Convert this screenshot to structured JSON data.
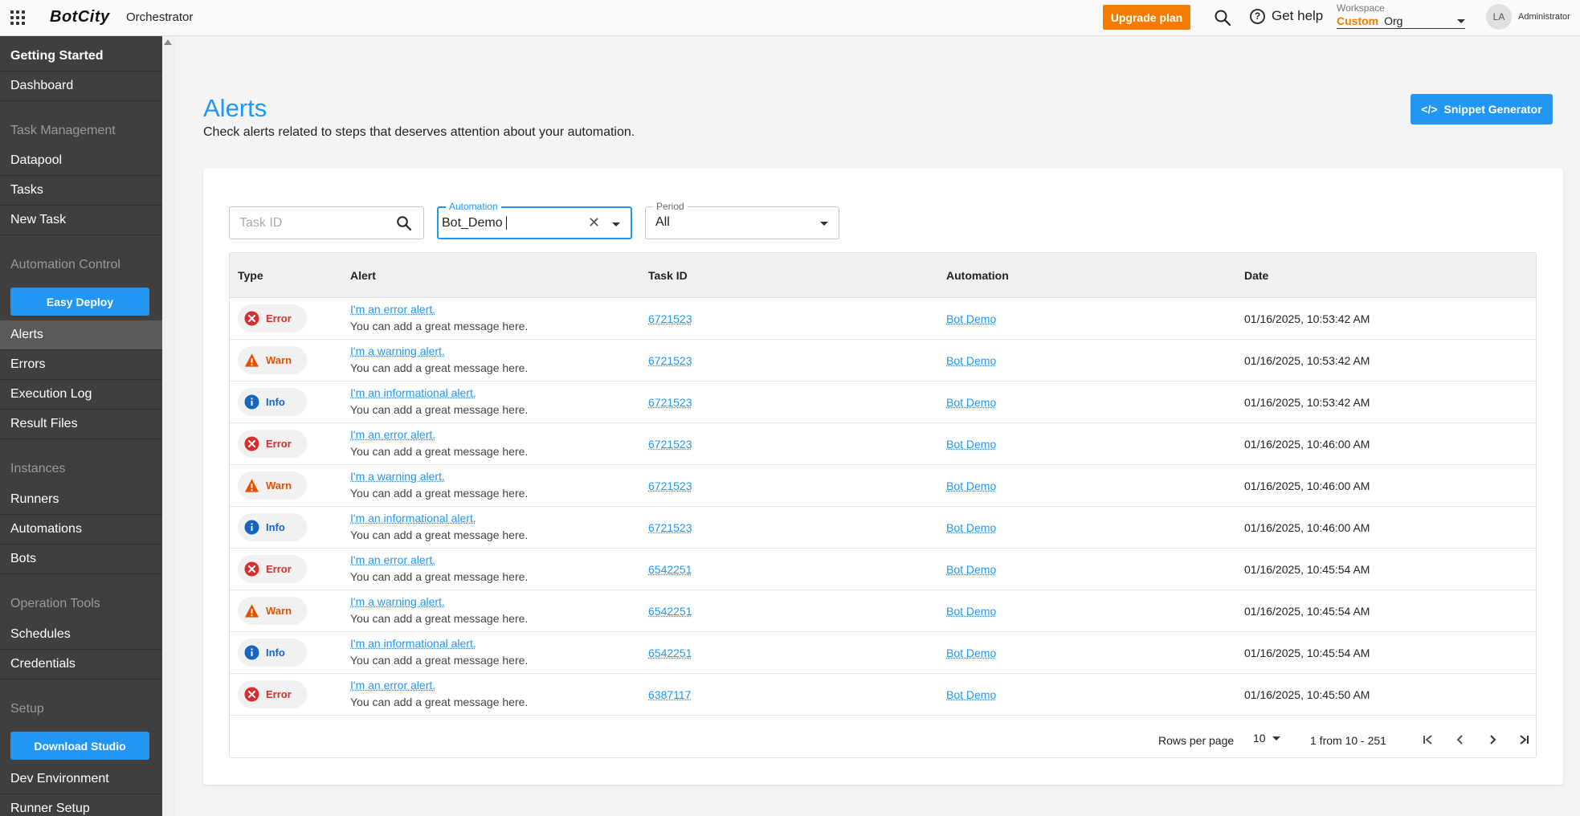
{
  "topbar": {
    "logo": "BotCity",
    "product": "Orchestrator",
    "upgrade_label": "Upgrade plan",
    "help_label": "Get help",
    "workspace_label": "Workspace",
    "workspace_custom": "Custom",
    "workspace_org": "Org",
    "avatar_initials": "LA",
    "user_role": "Administrator"
  },
  "sidebar": {
    "getting_started": "Getting Started",
    "dashboard": "Dashboard",
    "task_management": "Task Management",
    "datapool": "Datapool",
    "tasks": "Tasks",
    "new_task": "New Task",
    "automation_control": "Automation Control",
    "easy_deploy": "Easy Deploy",
    "alerts": "Alerts",
    "errors": "Errors",
    "execution_log": "Execution Log",
    "result_files": "Result Files",
    "instances": "Instances",
    "runners": "Runners",
    "automations": "Automations",
    "bots": "Bots",
    "operation_tools": "Operation Tools",
    "schedules": "Schedules",
    "credentials": "Credentials",
    "setup": "Setup",
    "download_studio": "Download Studio",
    "dev_environment": "Dev Environment",
    "runner_setup": "Runner Setup"
  },
  "page": {
    "title": "Alerts",
    "subtitle": "Check alerts related to steps that deserves attention about your automation.",
    "snippet_label": "Snippet Generator",
    "snippet_icon": "</>"
  },
  "filters": {
    "task_id_placeholder": "Task ID",
    "automation_label": "Automation",
    "automation_value": "Bot_Demo",
    "period_label": "Period",
    "period_value": "All"
  },
  "table": {
    "headers": {
      "type": "Type",
      "alert": "Alert",
      "task_id": "Task ID",
      "automation": "Automation",
      "date": "Date"
    },
    "rows": [
      {
        "type": "Error",
        "alert": "I'm an error alert.",
        "message": "You can add a great message here.",
        "task_id": "6721523",
        "automation": "Bot Demo",
        "date": "01/16/2025, 10:53:42 AM"
      },
      {
        "type": "Warn",
        "alert": "I'm a warning alert.",
        "message": "You can add a great message here.",
        "task_id": "6721523",
        "automation": "Bot Demo",
        "date": "01/16/2025, 10:53:42 AM"
      },
      {
        "type": "Info",
        "alert": "I'm an informational alert.",
        "message": "You can add a great message here.",
        "task_id": "6721523",
        "automation": "Bot Demo",
        "date": "01/16/2025, 10:53:42 AM"
      },
      {
        "type": "Error",
        "alert": "I'm an error alert.",
        "message": "You can add a great message here.",
        "task_id": "6721523",
        "automation": "Bot Demo",
        "date": "01/16/2025, 10:46:00 AM"
      },
      {
        "type": "Warn",
        "alert": "I'm a warning alert.",
        "message": "You can add a great message here.",
        "task_id": "6721523",
        "automation": "Bot Demo",
        "date": "01/16/2025, 10:46:00 AM"
      },
      {
        "type": "Info",
        "alert": "I'm an informational alert.",
        "message": "You can add a great message here.",
        "task_id": "6721523",
        "automation": "Bot Demo",
        "date": "01/16/2025, 10:46:00 AM"
      },
      {
        "type": "Error",
        "alert": "I'm an error alert.",
        "message": "You can add a great message here.",
        "task_id": "6542251",
        "automation": "Bot Demo",
        "date": "01/16/2025, 10:45:54 AM"
      },
      {
        "type": "Warn",
        "alert": "I'm a warning alert.",
        "message": "You can add a great message here.",
        "task_id": "6542251",
        "automation": "Bot Demo",
        "date": "01/16/2025, 10:45:54 AM"
      },
      {
        "type": "Info",
        "alert": "I'm an informational alert.",
        "message": "You can add a great message here.",
        "task_id": "6542251",
        "automation": "Bot Demo",
        "date": "01/16/2025, 10:45:54 AM"
      },
      {
        "type": "Error",
        "alert": "I'm an error alert.",
        "message": "You can add a great message here.",
        "task_id": "6387117",
        "automation": "Bot Demo",
        "date": "01/16/2025, 10:45:50 AM"
      }
    ]
  },
  "pagination": {
    "rows_per_page_label": "Rows per page",
    "rows_per_page_value": "10",
    "range_text": "1 from 10 - 251"
  },
  "colors": {
    "accent": "#2196f3",
    "upgrade": "#f57c00",
    "error": "#d32f2f",
    "warn": "#e65100",
    "info": "#1565c0"
  }
}
